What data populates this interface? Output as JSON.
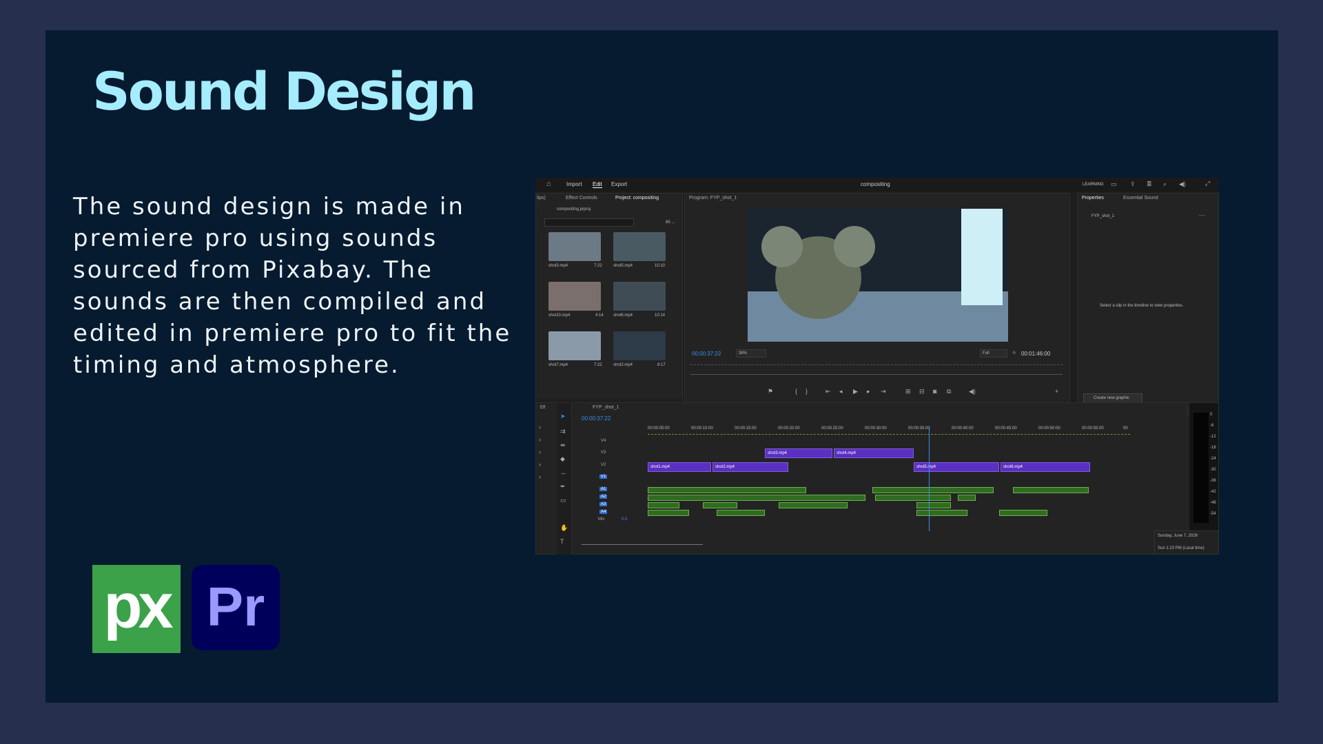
{
  "slide": {
    "title": "Sound Design",
    "body": "The sound design is made in premiere pro using sounds sourced from Pixabay. The sounds are then compiled and edited in premiere pro to fit the timing and atmosphere.",
    "logos": [
      {
        "name": "pixabay",
        "text": "px",
        "color": "#3ba24a"
      },
      {
        "name": "premiere-pro",
        "text": "Pr",
        "color": "#00005b",
        "accent": "#9999ff"
      }
    ],
    "title_color": "#a6ecff",
    "background": "#061b2f"
  },
  "premiere": {
    "menu": [
      "Import",
      "Edit",
      "Export"
    ],
    "document_title": "compositing",
    "workspace": "LEARNING",
    "project_panel": {
      "tabs": [
        "lips)",
        "Effect Controls",
        "Project: compositing"
      ],
      "project_file": "compositing.prproj",
      "item_count": "65 ...",
      "items": [
        {
          "name": "shot3.mp4",
          "duration": "7:22"
        },
        {
          "name": "shot5.mp4",
          "duration": "10:10"
        },
        {
          "name": "shot10.mp4",
          "duration": "4:14"
        },
        {
          "name": "shot6.mp4",
          "duration": "10:14"
        },
        {
          "name": "shot7.mp4",
          "duration": "7:22"
        },
        {
          "name": "shot2.mp4",
          "duration": "8:17"
        }
      ]
    },
    "program_monitor": {
      "tab": "Program: FYP_shot_1",
      "current_time": "00:00:37:22",
      "zoom": "38%",
      "resolution": "Full",
      "duration": "00:01:46:00"
    },
    "properties_panel": {
      "tabs": [
        "Properties",
        "Essential Sound"
      ],
      "sequence": "FYP_shot_1",
      "hint": "Select a clip in the timeline to view properties.",
      "button": "Create new graphic"
    },
    "timeline": {
      "tab": "FYP_shot_1",
      "current_time": "00:00:37:22",
      "ruler": [
        "00:00:05:00",
        "00:00:10:00",
        "00:00:15:00",
        "00:00:20:00",
        "00:00:25:00",
        "00:00:30:00",
        "00:00:35:00",
        "00:00:40:00",
        "00:00:45:00",
        "00:00:50:00",
        "00:00:55:00",
        "00"
      ],
      "video_tracks": [
        "V4",
        "V3",
        "V2",
        "V1"
      ],
      "audio_tracks": [
        "A1",
        "A2",
        "A3",
        "A4"
      ],
      "mix_label": "Mix",
      "mix_value": "0.0",
      "clips": [
        "shot3.mp4",
        "shot4.mp4",
        "shot1.mp4",
        "shot2.mp4",
        "shot5.mp4",
        "shot6.mp4"
      ],
      "meter_ticks": [
        "0",
        "-6",
        "-12",
        "-18",
        "-24",
        "-30",
        "-36",
        "-42",
        "-48",
        "-54"
      ]
    },
    "effects_tab": "Eff",
    "taskbar": {
      "date": "Sunday, June 7, 2026",
      "time": "Sun 1:23 PM (Local time)"
    }
  }
}
